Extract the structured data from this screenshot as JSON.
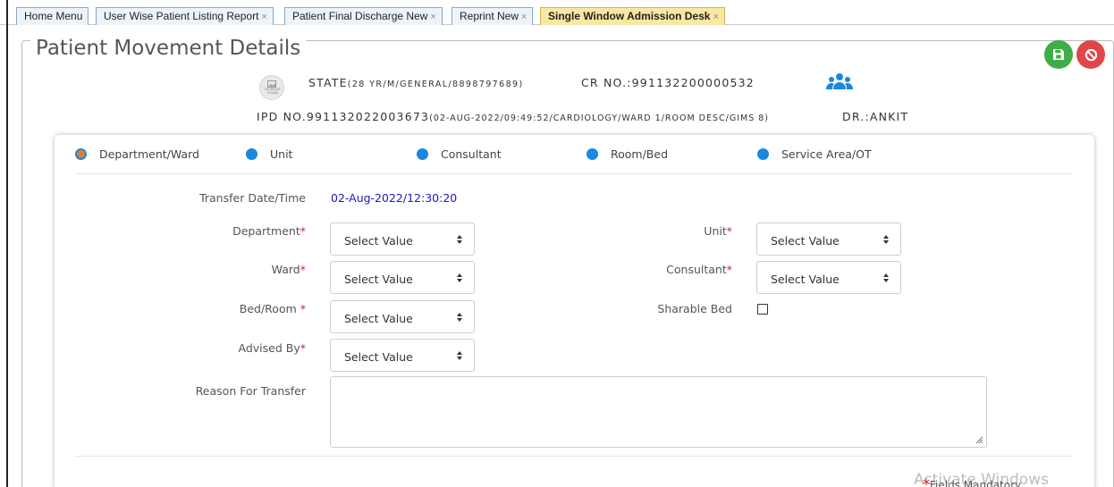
{
  "tabs": [
    {
      "label": "Home Menu",
      "closable": false
    },
    {
      "label": "User Wise Patient Listing Report",
      "closable": true
    },
    {
      "label": "Patient Final Discharge New",
      "closable": true
    },
    {
      "label": "Reprint New",
      "closable": true
    },
    {
      "label": "Single Window Admission Desk",
      "closable": true,
      "active": true
    }
  ],
  "tab_close_glyph": "×",
  "page": {
    "title": "Patient Movement Details"
  },
  "actions": {
    "save_icon": "save-icon",
    "cancel_icon": "ban-icon",
    "save_color": "#3fae49",
    "cancel_color": "#e0454b"
  },
  "patient": {
    "photo_placeholder": "NO IMAGE FOUND",
    "name": "STATE",
    "details": "(28 YR/M/GENERAL/8898797689)",
    "cr_no": "CR NO.:991132200000532",
    "ipd_no": "IPD NO.991132022003673",
    "admission_details": "(02-AUG-2022/09:49:52/CARDIOLOGY/WARD 1/ROOM DESC/GIMS 8)",
    "doctor": "DR.:ANKIT"
  },
  "steps": [
    {
      "label": "Department/Ward",
      "active": true
    },
    {
      "label": "Unit"
    },
    {
      "label": "Consultant"
    },
    {
      "label": "Room/Bed"
    },
    {
      "label": "Service Area/OT"
    }
  ],
  "form": {
    "transfer_datetime_label": "Transfer Date/Time",
    "transfer_datetime_value": "02-Aug-2022/12:30:20",
    "department_label": "Department",
    "department_value": "Select Value",
    "ward_label": "Ward",
    "ward_value": "Select Value",
    "bed_room_label": "Bed/Room ",
    "bed_room_value": "Select Value",
    "advised_by_label": "Advised By",
    "advised_by_value": "Select Value",
    "unit_label": "Unit",
    "unit_value": "Select Value",
    "consultant_label": "Consultant",
    "consultant_value": "Select Value",
    "sharable_bed_label": "Sharable Bed",
    "reason_label": "Reason For Transfer",
    "reason_value": "",
    "required_marker": "*"
  },
  "footer": {
    "mandatory_note": "Fields Mandatory",
    "required_marker": "*",
    "watermark": "Activate Windows"
  },
  "colors": {
    "accent_blue": "#1a88e0",
    "active_step": "#e87a2c",
    "required": "#d42020",
    "value_blue": "#1b1bb8",
    "active_tab": "#f9e7a3"
  }
}
